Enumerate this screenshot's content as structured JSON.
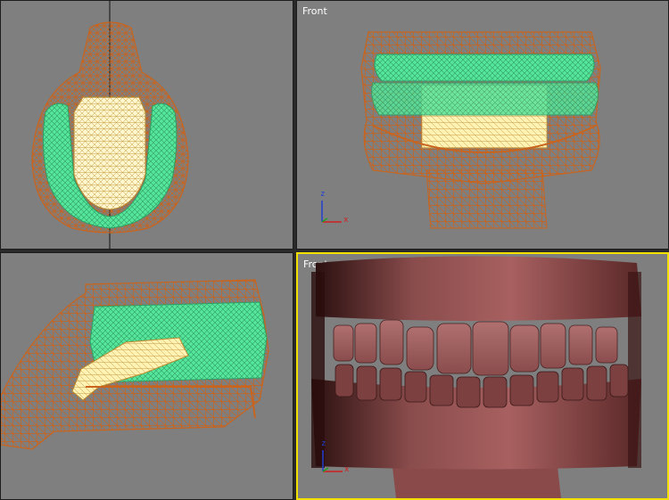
{
  "viewports": {
    "top": {
      "label": ""
    },
    "front": {
      "label": "Front",
      "axis_z": "z",
      "axis_x": "x"
    },
    "left": {
      "label": ""
    },
    "perspective": {
      "label": "Front",
      "axis_z": "z",
      "axis_x": "x"
    }
  },
  "colors": {
    "viewport_bg": "#7f7f7f",
    "wire_orange": "#c8641e",
    "wire_green": "#55e69b",
    "wire_cream": "#fff2b3",
    "active_border": "#f2e000",
    "axis_x": "#d02020",
    "axis_z": "#2040d0",
    "axis_y": "#20a020"
  }
}
